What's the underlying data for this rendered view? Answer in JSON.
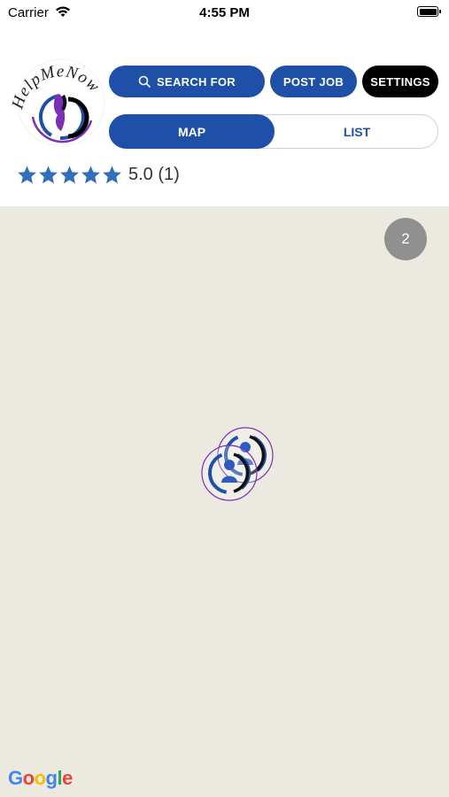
{
  "status_bar": {
    "carrier": "Carrier",
    "time": "4:55 PM",
    "icons": [
      "wifi-icon",
      "battery-icon"
    ]
  },
  "header": {
    "logo_text": "HelpMeNow",
    "buttons": {
      "search": "SEARCH FOR",
      "post_job": "POST JOB",
      "settings": "SETTINGS"
    },
    "view_toggle": {
      "map": "MAP",
      "list": "LIST",
      "selected": "map"
    },
    "rating": {
      "stars": 5,
      "text": "5.0 (1)"
    }
  },
  "map": {
    "cluster_count": "2",
    "markers_count": 2,
    "attribution": "Google"
  },
  "colors": {
    "primary": "#1f50a8",
    "black": "#000000",
    "star": "#2f6fba",
    "map_bg": "#ece9e1",
    "cluster": "#909090",
    "logo_purple": "#7b2fb4"
  }
}
